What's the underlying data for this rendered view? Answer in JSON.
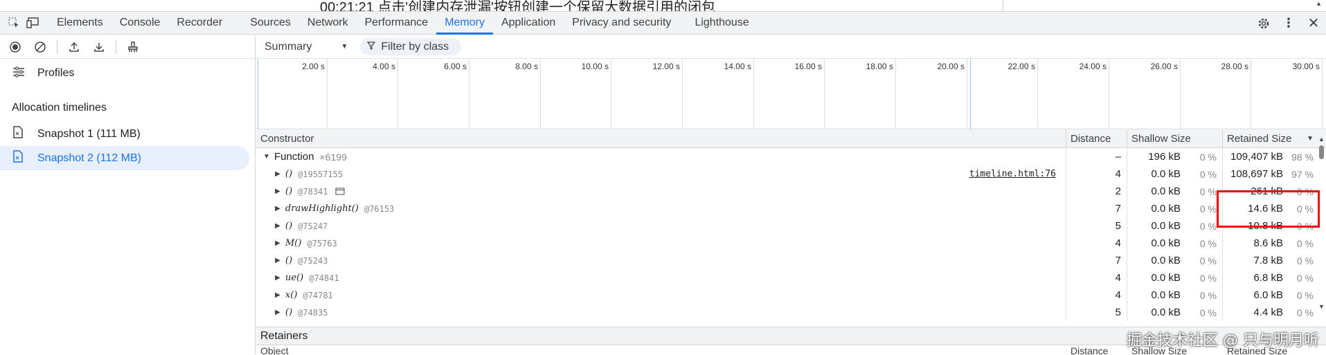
{
  "page": {
    "caption": "00:21:21 点击'创建内存泄漏'按钮创建一个保留大数据引用的闭包"
  },
  "devtools": {
    "tabs": [
      "Elements",
      "Console",
      "Recorder",
      "Sources",
      "Network",
      "Performance",
      "Memory",
      "Application",
      "Privacy and security",
      "Lighthouse"
    ],
    "active_tab": "Memory"
  },
  "left": {
    "profiles_label": "Profiles",
    "section_title": "Allocation timelines",
    "snapshots": [
      "Snapshot 1 (111 MB)",
      "Snapshot 2 (112 MB)"
    ],
    "selected_snapshot": "Snapshot 2 (112 MB)"
  },
  "toolbar": {
    "view": "Summary",
    "filter_placeholder": "Filter by class"
  },
  "timeline": {
    "ticks": [
      "2.00 s",
      "4.00 s",
      "6.00 s",
      "8.00 s",
      "10.00 s",
      "12.00 s",
      "14.00 s",
      "16.00 s",
      "18.00 s",
      "20.00 s",
      "22.00 s",
      "24.00 s",
      "26.00 s",
      "28.00 s",
      "30.00 s"
    ]
  },
  "table": {
    "headers": {
      "constructor": "Constructor",
      "distance": "Distance",
      "shallow": "Shallow Size",
      "retained": "Retained Size"
    },
    "group": {
      "name": "Function",
      "count": "×6199",
      "distance": "–",
      "shallow": "196 kB",
      "shallow_pct": "0 %",
      "retained": "109,407 kB",
      "retained_pct": "98 %"
    },
    "rows": [
      {
        "name": "()",
        "id": "@19557155",
        "link": "timeline.html:76",
        "distance": "4",
        "shallow": "0.0 kB",
        "shallow_pct": "0 %",
        "retained": "108,697 kB",
        "retained_pct": "97 %"
      },
      {
        "name": "()",
        "id": "@78341",
        "distance": "2",
        "shallow": "0.0 kB",
        "shallow_pct": "0 %",
        "retained": "261 kB",
        "retained_pct": "0 %"
      },
      {
        "name": "drawHighlight()",
        "id": "@76153",
        "distance": "7",
        "shallow": "0.0 kB",
        "shallow_pct": "0 %",
        "retained": "14.6 kB",
        "retained_pct": "0 %"
      },
      {
        "name": "()",
        "id": "@75247",
        "distance": "5",
        "shallow": "0.0 kB",
        "shallow_pct": "0 %",
        "retained": "10.8 kB",
        "retained_pct": "0 %"
      },
      {
        "name": "M()",
        "id": "@75763",
        "distance": "4",
        "shallow": "0.0 kB",
        "shallow_pct": "0 %",
        "retained": "8.6 kB",
        "retained_pct": "0 %"
      },
      {
        "name": "()",
        "id": "@75243",
        "distance": "7",
        "shallow": "0.0 kB",
        "shallow_pct": "0 %",
        "retained": "7.8 kB",
        "retained_pct": "0 %"
      },
      {
        "name": "ue()",
        "id": "@74841",
        "distance": "4",
        "shallow": "0.0 kB",
        "shallow_pct": "0 %",
        "retained": "6.8 kB",
        "retained_pct": "0 %"
      },
      {
        "name": "x()",
        "id": "@74781",
        "distance": "4",
        "shallow": "0.0 kB",
        "shallow_pct": "0 %",
        "retained": "6.0 kB",
        "retained_pct": "0 %"
      },
      {
        "name": "()",
        "id": "@74835",
        "distance": "5",
        "shallow": "0.0 kB",
        "shallow_pct": "0 %",
        "retained": "4.4 kB",
        "retained_pct": "0 %"
      }
    ]
  },
  "retainers": {
    "title": "Retainers",
    "headers": {
      "object": "Object",
      "distance": "Distance",
      "shallow": "Shallow Size",
      "retained": "Retained Size"
    }
  },
  "watermark": "掘金技术社区 @ 只与明月听"
}
